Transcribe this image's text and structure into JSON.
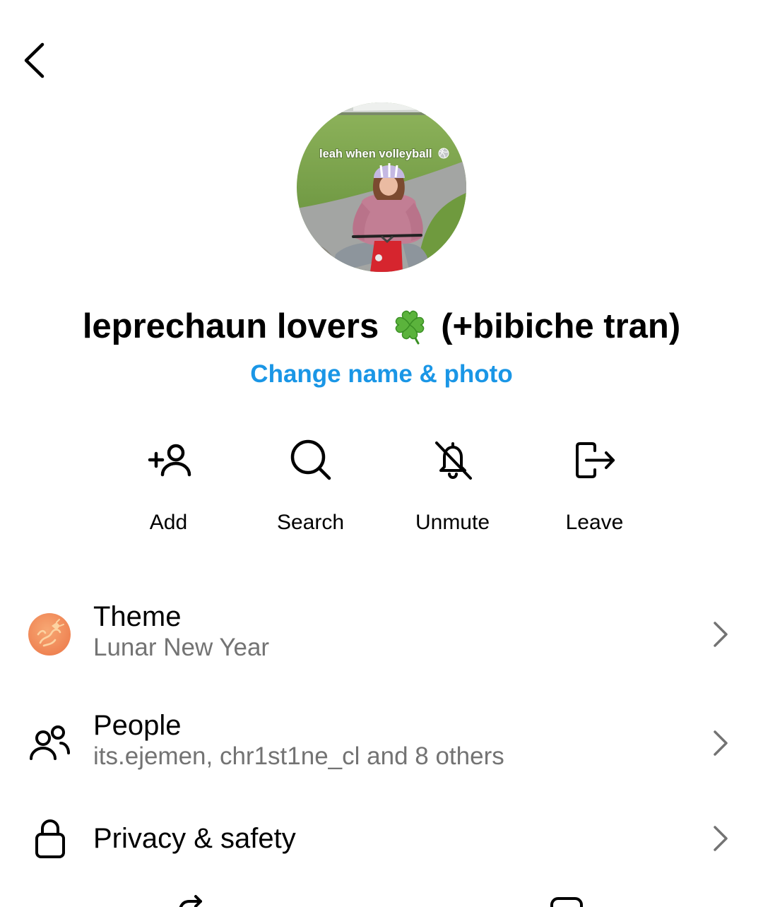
{
  "header": {
    "back_icon": "chevron-left-icon"
  },
  "group": {
    "avatar": {
      "caption": "leah when volleyball",
      "caption_icon": "volleyball-icon"
    },
    "title_before": "leprechaun lovers",
    "title_emoji_icon": "four-leaf-clover-icon",
    "title_after": "(+bibiche tran)",
    "edit_link": "Change name & photo"
  },
  "actions": [
    {
      "label": "Add",
      "icon": "add-person-icon"
    },
    {
      "label": "Search",
      "icon": "search-icon"
    },
    {
      "label": "Unmute",
      "icon": "bell-off-icon"
    },
    {
      "label": "Leave",
      "icon": "leave-icon"
    }
  ],
  "settings": [
    {
      "title": "Theme",
      "subtitle": "Lunar New Year",
      "icon": "dragon-theme-icon"
    },
    {
      "title": "People",
      "subtitle": "its.ejemen, chr1st1ne_cl and 8 others",
      "icon": "people-icon"
    },
    {
      "title": "Privacy & safety",
      "icon": "lock-icon"
    }
  ],
  "partial_row": {
    "icons": [
      "share-arrow-icon",
      "media-icon"
    ]
  },
  "colors": {
    "accent": "#1a96e6",
    "text": "#000000",
    "secondary_text": "#737373",
    "theme_icon": "#ee7f4f"
  }
}
